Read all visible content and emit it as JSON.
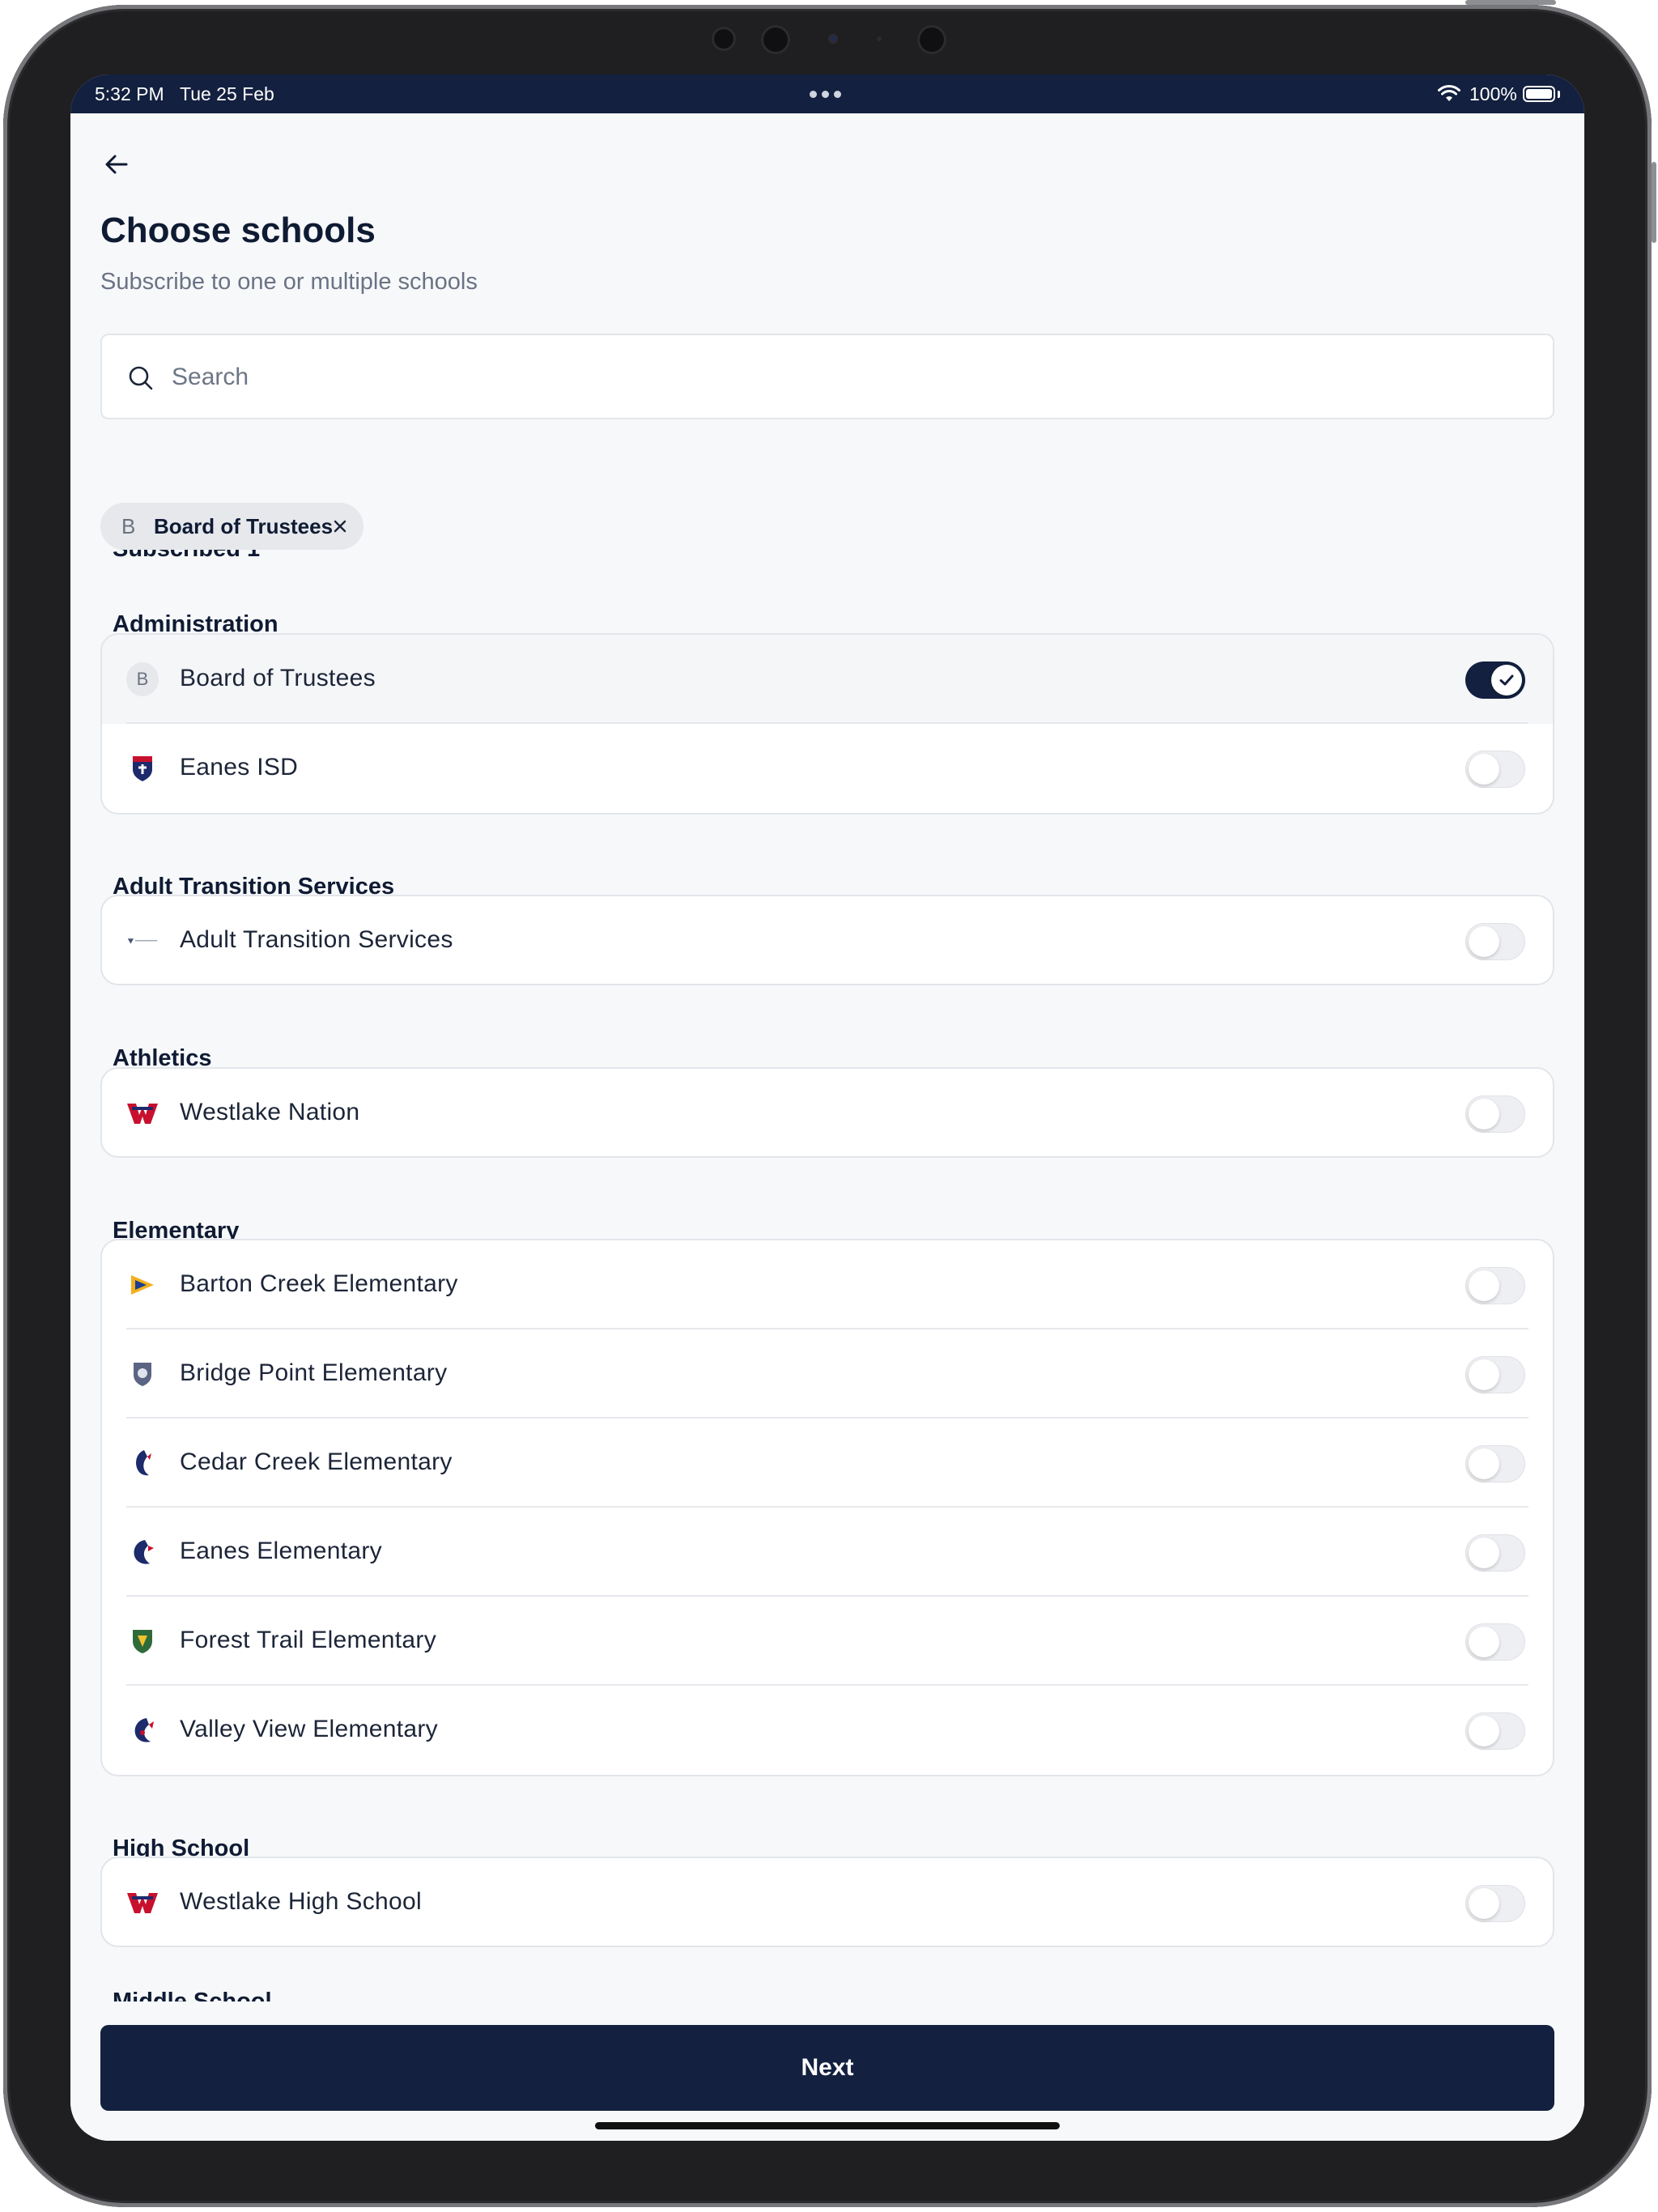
{
  "status_bar": {
    "time": "5:32 PM",
    "date": "Tue 25 Feb",
    "battery": "100%"
  },
  "page": {
    "title": "Choose schools",
    "subtitle": "Subscribe to one or multiple schools"
  },
  "search": {
    "placeholder": "Search",
    "value": ""
  },
  "subscribed": {
    "heading": "Subscribed 1",
    "chips": [
      {
        "letter": "B",
        "label": "Board of Trustees"
      }
    ]
  },
  "sections": [
    {
      "title": "Administration",
      "items": [
        {
          "label": "Board of Trustees",
          "icon": "letter-badge",
          "letter": "B",
          "subscribed": true
        },
        {
          "label": "Eanes ISD",
          "icon": "shield-logo-icon",
          "subscribed": false
        }
      ]
    },
    {
      "title": "Adult Transition Services",
      "items": [
        {
          "label": "Adult Transition Services",
          "icon": "ats-logo-icon",
          "subscribed": false
        }
      ]
    },
    {
      "title": "Athletics",
      "items": [
        {
          "label": "Westlake Nation",
          "icon": "westlake-w-logo-icon",
          "subscribed": false
        }
      ]
    },
    {
      "title": "Elementary",
      "items": [
        {
          "label": "Barton Creek Elementary",
          "icon": "barton-creek-logo-icon",
          "subscribed": false
        },
        {
          "label": "Bridge Point Elementary",
          "icon": "bridge-point-logo-icon",
          "subscribed": false
        },
        {
          "label": "Cedar Creek Elementary",
          "icon": "cedar-creek-logo-icon",
          "subscribed": false
        },
        {
          "label": "Eanes Elementary",
          "icon": "eanes-elementary-logo-icon",
          "subscribed": false
        },
        {
          "label": "Forest Trail Elementary",
          "icon": "forest-trail-logo-icon",
          "subscribed": false
        },
        {
          "label": "Valley View Elementary",
          "icon": "valley-view-logo-icon",
          "subscribed": false
        }
      ]
    },
    {
      "title": "High School",
      "items": [
        {
          "label": "Westlake High School",
          "icon": "westlake-w-logo-icon",
          "subscribed": false
        }
      ]
    }
  ],
  "cut_off_section": "Middle School",
  "footer": {
    "next_label": "Next"
  },
  "colors": {
    "primary": "#13203f",
    "background": "#f7f8fa",
    "border": "#e2e5ea",
    "muted_text": "#6a7385"
  }
}
